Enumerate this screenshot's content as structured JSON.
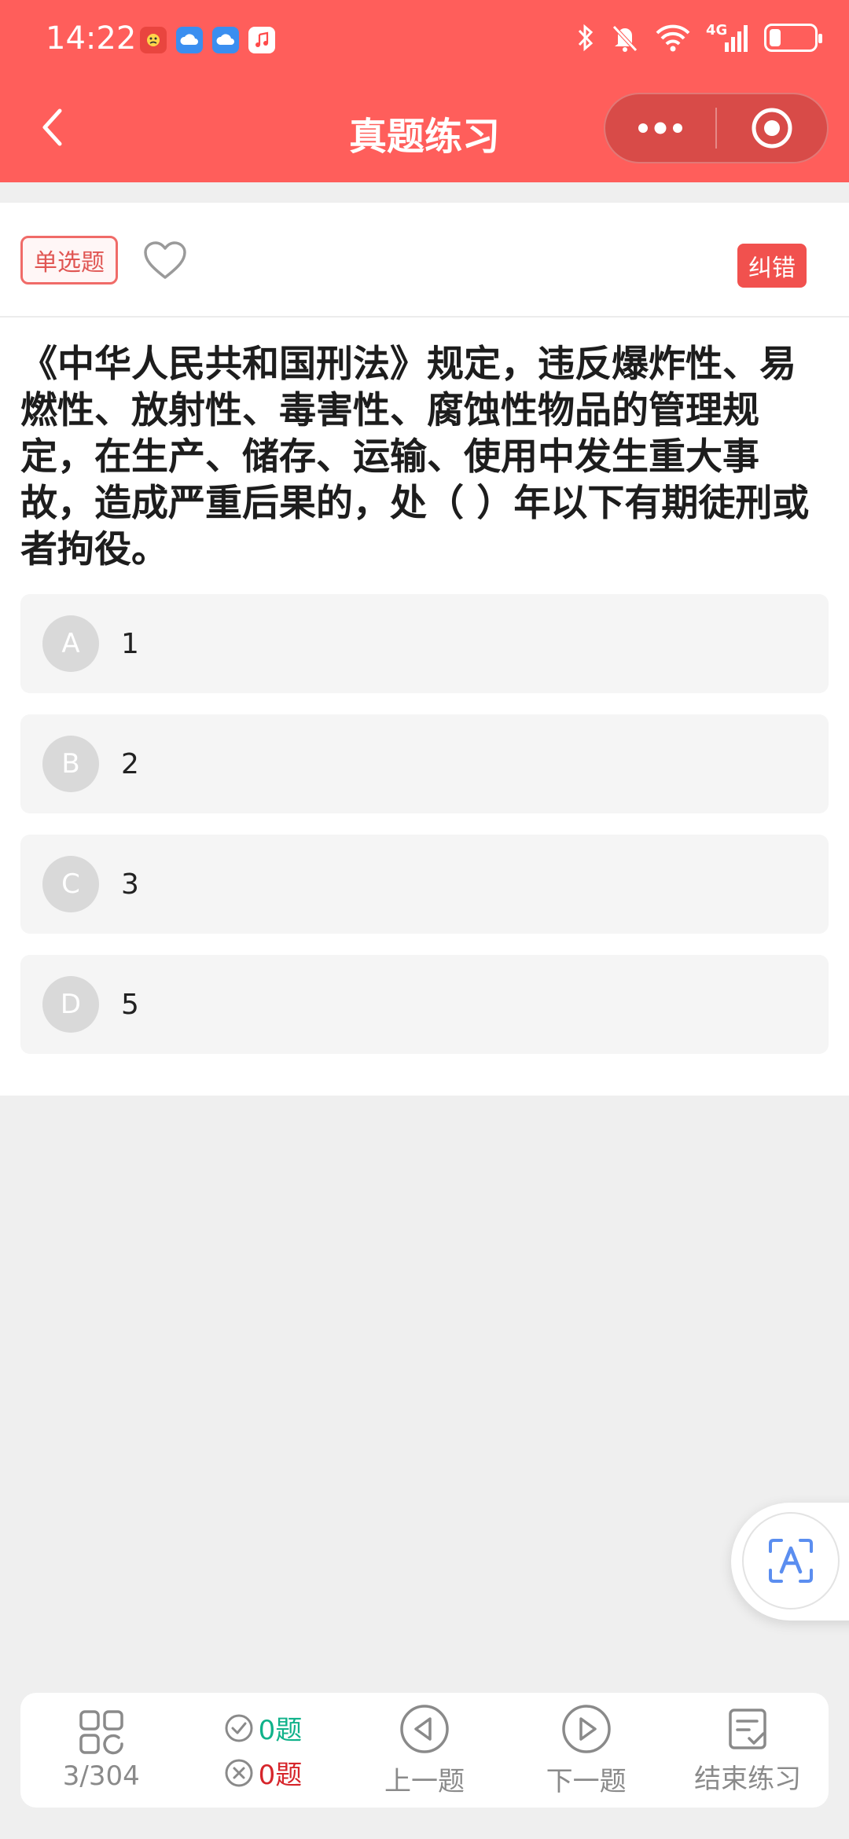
{
  "status_bar": {
    "time": "14:22",
    "network": "4G",
    "battery_level": 0.25,
    "icons": [
      "notification-app-icon",
      "cloud-icon",
      "cloud-icon",
      "music-icon",
      "bluetooth-icon",
      "mute-icon",
      "wifi-icon",
      "signal-icon",
      "battery-icon"
    ]
  },
  "nav": {
    "title": "真题练习",
    "back_icon": "chevron-left-icon",
    "more_icon": "more-dots-icon",
    "close_icon": "target-close-icon"
  },
  "question": {
    "type_label": "单选题",
    "report_label": "纠错",
    "text": "《中华人民共和国刑法》规定，违反爆炸性、易燃性、放射性、毒害性、腐蚀性物品的管理规定，在生产、储存、运输、使用中发生重大事故，造成严重后果的，处（ ）年以下有期徒刑或者拘役。",
    "options": [
      {
        "letter": "A",
        "text": "1"
      },
      {
        "letter": "B",
        "text": "2"
      },
      {
        "letter": "C",
        "text": "3"
      },
      {
        "letter": "D",
        "text": "5"
      }
    ]
  },
  "bottom_bar": {
    "progress": "3/304",
    "correct_count": "0题",
    "wrong_count": "0题",
    "prev_label": "上一题",
    "next_label": "下一题",
    "finish_label": "结束练习"
  },
  "colors": {
    "primary": "#ff5e5b",
    "report": "#f1514e",
    "correct": "#10b28a",
    "wrong": "#d6252b"
  }
}
